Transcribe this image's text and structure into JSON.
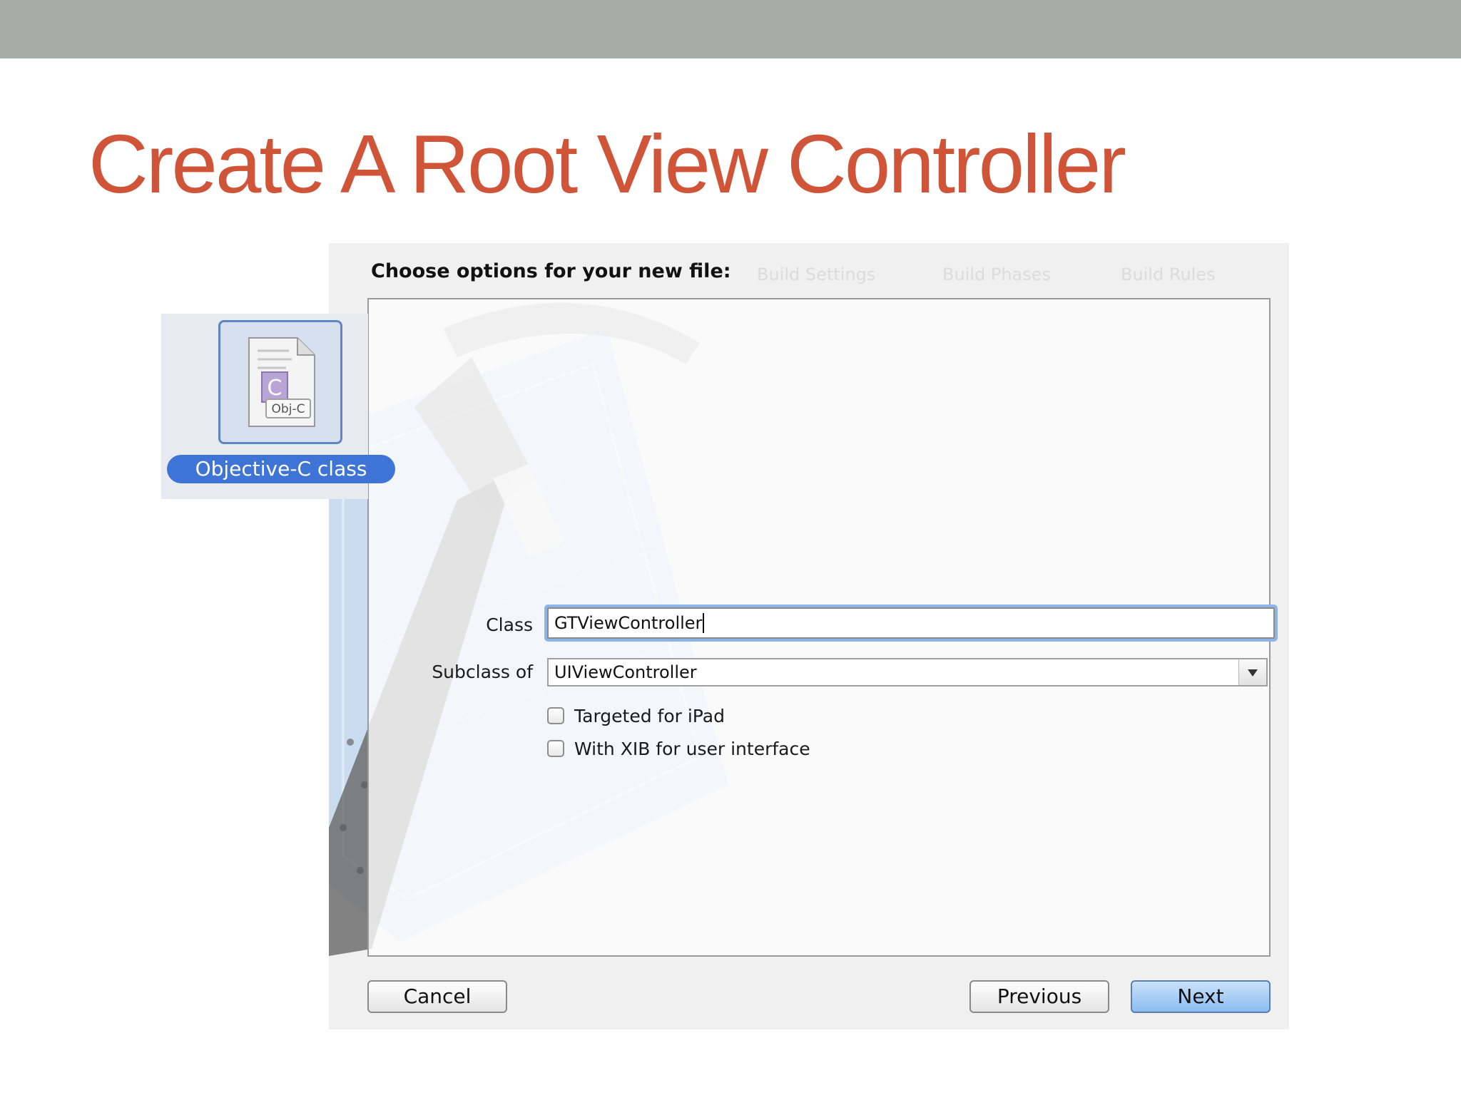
{
  "slide": {
    "title": "Create A Root View Controller"
  },
  "template": {
    "label": "Objective-C class",
    "icon_badge": "Obj-C",
    "icon_letter": "C",
    "icon": "objective-c-file-icon"
  },
  "dialog": {
    "heading": "Choose options for your new file:",
    "background_tabs": [
      "Build Settings",
      "Build Phases",
      "Build Rules"
    ],
    "fields": {
      "class_label": "Class",
      "class_value": "GTViewController",
      "subclass_label": "Subclass of",
      "subclass_value": "UIViewController"
    },
    "checkboxes": {
      "ipad_label": "Targeted for iPad",
      "ipad_checked": false,
      "xib_label": "With XIB for user interface",
      "xib_checked": false
    },
    "buttons": {
      "cancel": "Cancel",
      "previous": "Previous",
      "next": "Next"
    }
  },
  "colors": {
    "title": "#cf5438",
    "top_bar": "#a4ada8",
    "selection": "#3e74d6",
    "primary_button": "#8ebdf1"
  }
}
